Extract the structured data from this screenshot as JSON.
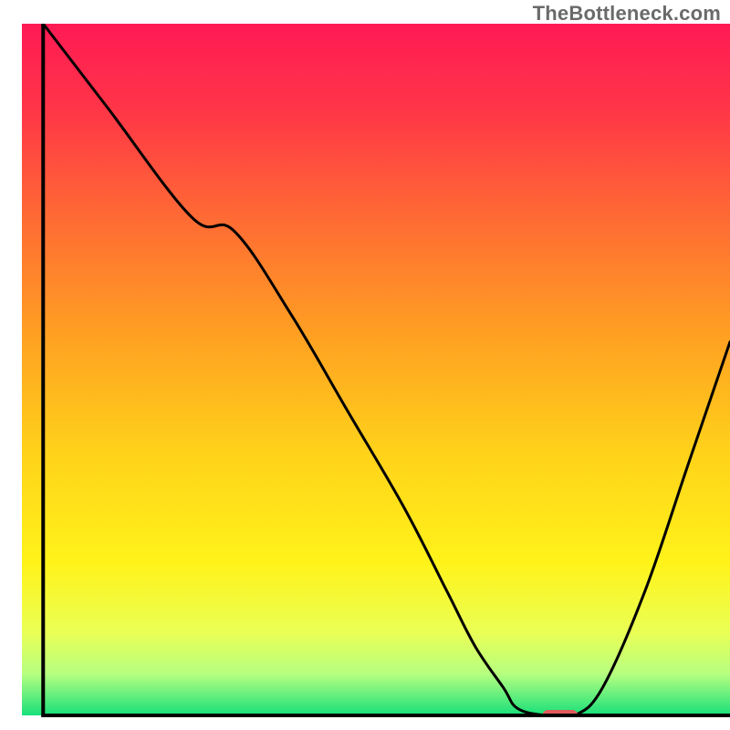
{
  "watermark": "TheBottleneck.com",
  "chart_data": {
    "type": "line",
    "title": "",
    "xlabel": "",
    "ylabel": "",
    "xlim": [
      0,
      100
    ],
    "ylim": [
      0,
      100
    ],
    "background_gradient": {
      "stops": [
        {
          "offset": 0.0,
          "color": "#ff1a55"
        },
        {
          "offset": 0.12,
          "color": "#ff3448"
        },
        {
          "offset": 0.28,
          "color": "#ff6a34"
        },
        {
          "offset": 0.45,
          "color": "#ffa022"
        },
        {
          "offset": 0.62,
          "color": "#ffd21a"
        },
        {
          "offset": 0.78,
          "color": "#fff31a"
        },
        {
          "offset": 0.88,
          "color": "#eaff55"
        },
        {
          "offset": 0.94,
          "color": "#b6ff80"
        },
        {
          "offset": 1.0,
          "color": "#18e07a"
        }
      ]
    },
    "series": [
      {
        "name": "bottleneck-curve",
        "color": "#000000",
        "x": [
          3,
          12,
          24,
          30,
          38,
          46,
          54,
          60,
          64,
          68,
          70,
          74,
          78,
          82,
          88,
          94,
          100
        ],
        "y": [
          100,
          88,
          72,
          70,
          58,
          44,
          30,
          18,
          10,
          4,
          1,
          0,
          0,
          4,
          18,
          36,
          54
        ]
      }
    ],
    "marker": {
      "name": "optimal-marker",
      "x": 76,
      "y": 0,
      "width": 5,
      "height": 1.6,
      "color": "#e05a5a"
    },
    "axes": {
      "left": {
        "x": 3,
        "y1": 0,
        "y2": 100
      },
      "bottom": {
        "y": 0,
        "x1": 3,
        "x2": 100
      }
    }
  }
}
